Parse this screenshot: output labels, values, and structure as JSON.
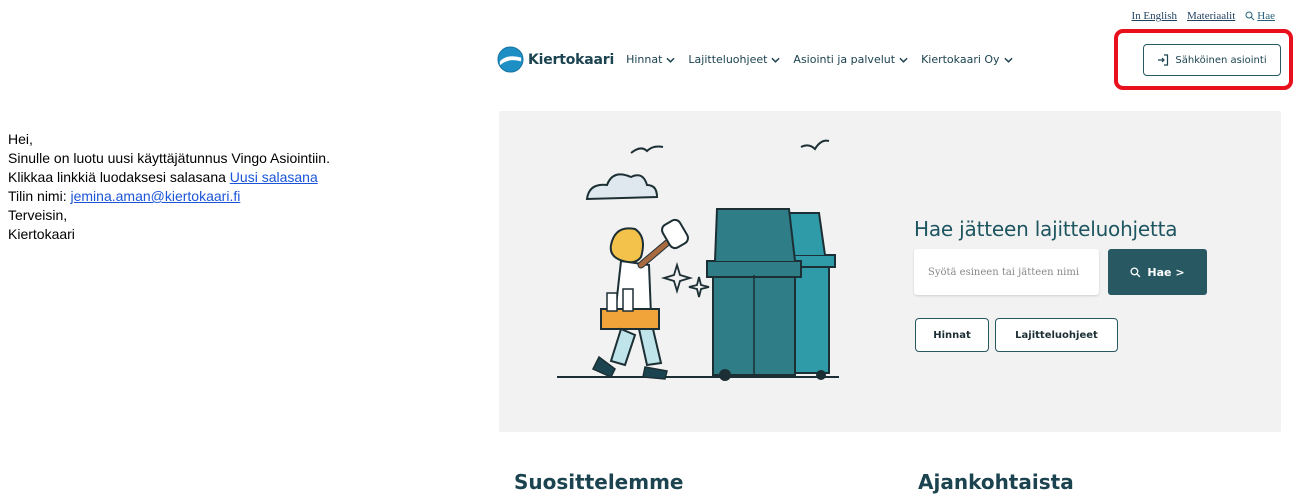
{
  "email": {
    "greeting": "Hei,",
    "line1": "Sinulle on luotu uusi käyttäjätunnus Vingo Asiointiin.",
    "line2_prefix": "Klikkaa linkkiä luodaksesi salasana ",
    "line2_link": "Uusi salasana",
    "line3_prefix": "Tilin nimi: ",
    "line3_link": "jemina.aman@kiertokaari.fi",
    "closing": "Terveisin,",
    "signature": "Kiertokaari"
  },
  "utility": {
    "english": "In English",
    "materials": "Materiaalit",
    "search": "Hae"
  },
  "nav": {
    "brand": "Kiertokaari",
    "items": [
      "Hinnat",
      "Lajitteluohjeet",
      "Asiointi ja palvelut",
      "Kiertokaari Oy"
    ],
    "eservice": "Sähköinen asiointi"
  },
  "hero": {
    "title": "Hae jätteen lajitteluohjetta",
    "search_placeholder": "Syötä esineen tai jätteen nimi",
    "search_button": "Hae >",
    "quick_links": [
      "Hinnat",
      "Lajitteluohjeet"
    ]
  },
  "sections": {
    "left": "Suosittelemme",
    "right": "Ajankohtaista"
  },
  "colors": {
    "brand_dark": "#1c4350",
    "button_teal": "#285963",
    "highlight_red": "#e8101c",
    "bin_teal": "#2f7d86"
  }
}
